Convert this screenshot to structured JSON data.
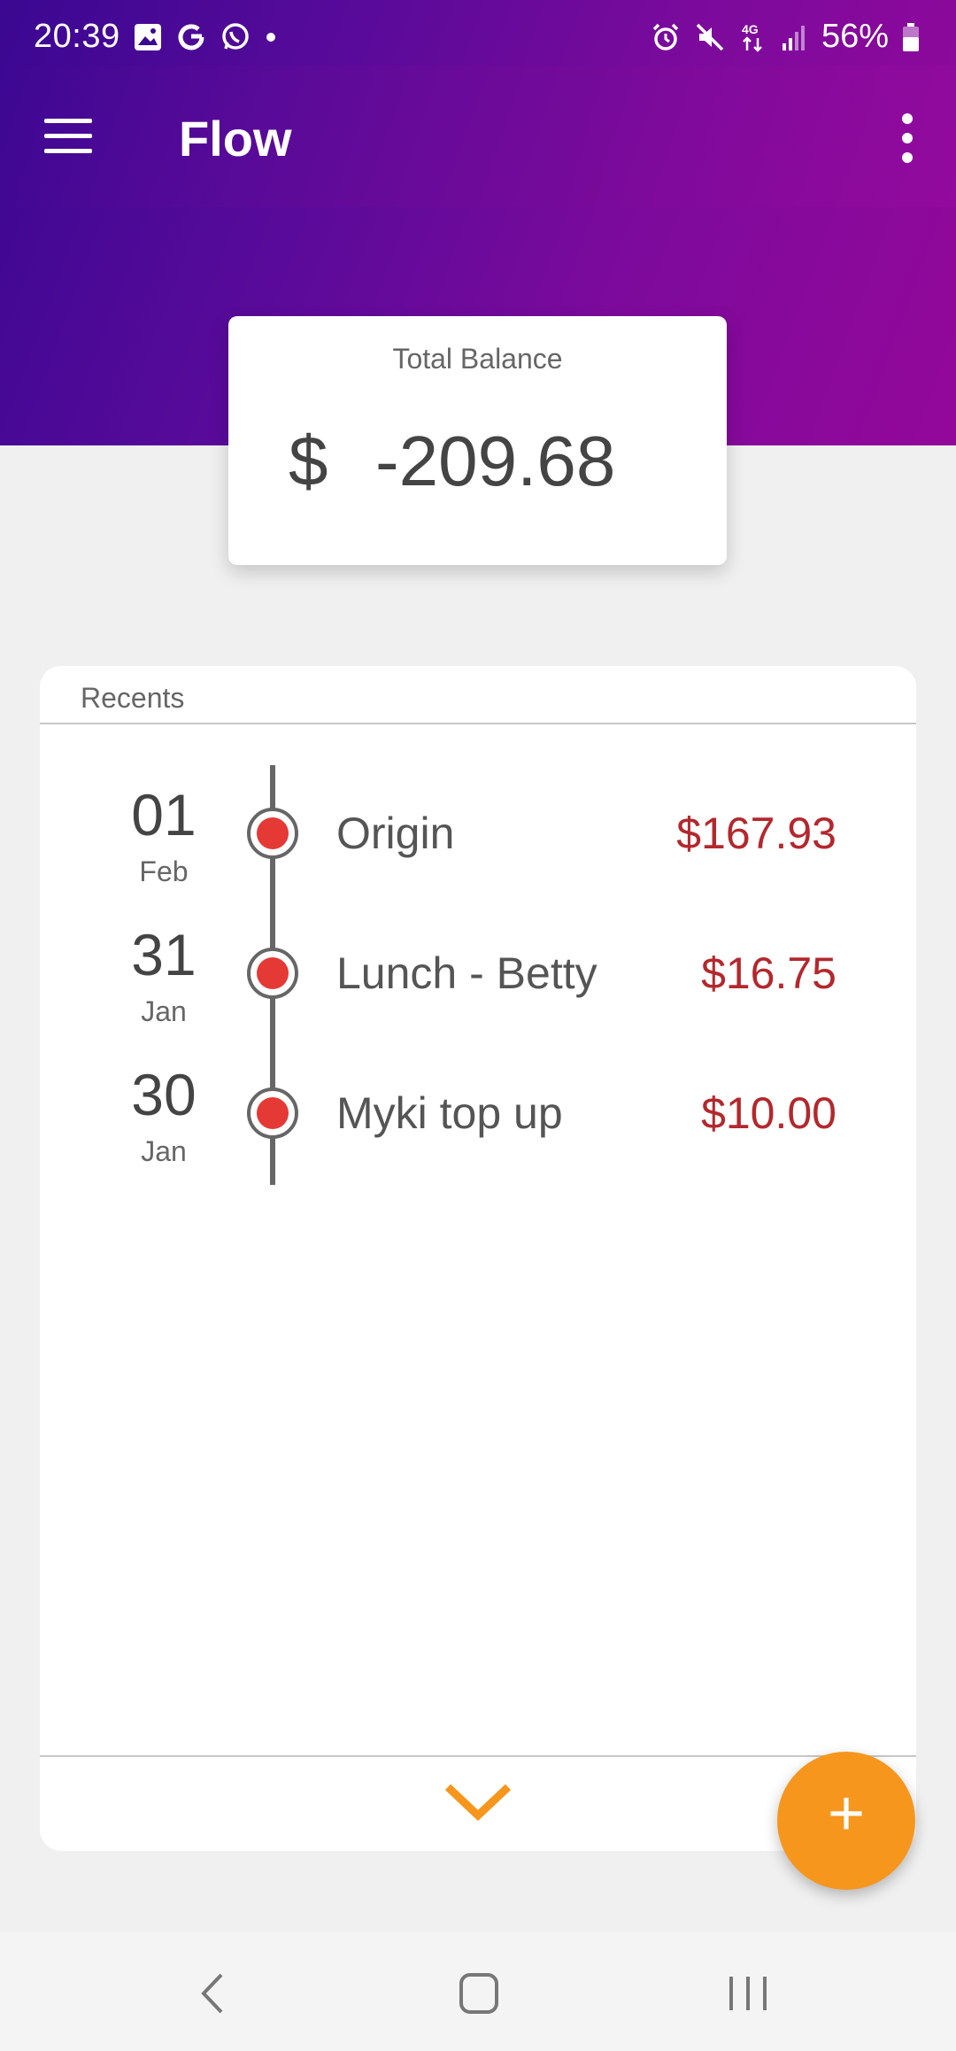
{
  "status_bar": {
    "time": "20:39",
    "battery": "56%",
    "network": "4G"
  },
  "app_bar": {
    "title": "Flow",
    "menu_icon": "hamburger-menu-icon",
    "overflow_icon": "more-vert-icon"
  },
  "balance": {
    "label": "Total Balance",
    "currency": "$",
    "value": "-209.68"
  },
  "recents": {
    "title": "Recents",
    "transactions": [
      {
        "day": "01",
        "month": "Feb",
        "name": "Origin",
        "amount": "$167.93"
      },
      {
        "day": "31",
        "month": "Jan",
        "name": "Lunch - Betty",
        "amount": "$16.75"
      },
      {
        "day": "30",
        "month": "Jan",
        "name": "Myki top up",
        "amount": "$10.00"
      }
    ],
    "expand_icon": "chevron-down-icon"
  },
  "fab": {
    "label": "+"
  },
  "colors": {
    "header_start": "#3a0892",
    "header_end": "#93089a",
    "accent": "#f7961c",
    "dot": "#e53935",
    "amount": "#b3282d"
  }
}
